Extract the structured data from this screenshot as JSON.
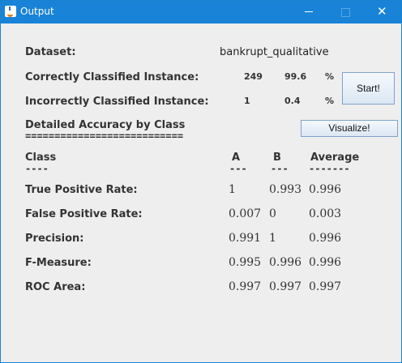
{
  "window": {
    "title": "Output"
  },
  "header": {
    "dataset_label": "Dataset:",
    "dataset_value": "bankrupt_qualitative",
    "correct_label": "Correctly Classified Instance:",
    "correct_count": "249",
    "correct_pct": "99.6",
    "correct_unit": "%",
    "incorrect_label": "Incorrectly Classified Instance:",
    "incorrect_count": "1",
    "incorrect_pct": "0.4",
    "incorrect_unit": "%",
    "start_button": "Start!",
    "visualize_button": "Visualize!"
  },
  "section": {
    "title": "Detailed Accuracy by Class",
    "title_underline": "==========================="
  },
  "table": {
    "columns": [
      {
        "label": "Class",
        "underline": "----"
      },
      {
        "label": "A",
        "underline": "---"
      },
      {
        "label": "B",
        "underline": "---"
      },
      {
        "label": "Average",
        "underline": "-------"
      }
    ],
    "rows": [
      {
        "label": "True Positive Rate:",
        "a": "1",
        "b": "0.993",
        "avg": "0.996"
      },
      {
        "label": "False Positive Rate:",
        "a": "0.007",
        "b": "0",
        "avg": "0.003"
      },
      {
        "label": "Precision:",
        "a": "0.991",
        "b": "1",
        "avg": "0.996"
      },
      {
        "label": "F-Measure:",
        "a": "0.995",
        "b": "0.996",
        "avg": "0.996"
      },
      {
        "label": "ROC Area:",
        "a": "0.997",
        "b": "0.997",
        "avg": "0.997"
      }
    ]
  }
}
